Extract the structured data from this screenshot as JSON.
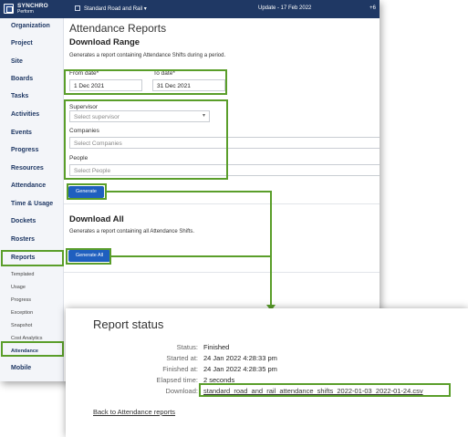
{
  "topbar": {
    "logo_line1": "SYNCHRO",
    "logo_line2": "Perform",
    "project": "Standard Road and Rail",
    "project_caret": "▾",
    "update": "Update - 17 Feb 2022",
    "extra": "+6"
  },
  "sidebar": {
    "items": [
      "Organization",
      "Project",
      "Site",
      "Boards",
      "Tasks",
      "Activities",
      "Events",
      "Progress",
      "Resources",
      "Attendance",
      "Time & Usage",
      "Dockets",
      "Rosters",
      "Reports",
      "Mobile"
    ],
    "sub_items": [
      "Templated",
      "Usage",
      "Progress",
      "Exception",
      "Snapshot",
      "Cost Analytics",
      "Attendance"
    ]
  },
  "main": {
    "page_title": "Attendance Reports",
    "range_heading": "Download Range",
    "range_desc": "Generates a report containing Attendance Shifts during a period.",
    "from_label": "From date*",
    "from_value": "1 Dec 2021",
    "to_label": "To date*",
    "to_value": "31 Dec 2021",
    "supervisor_label": "Supervisor",
    "supervisor_placeholder": "Select supervisor",
    "companies_label": "Companies",
    "companies_placeholder": "Select Companies",
    "people_label": "People",
    "people_placeholder": "Select People",
    "generate_label": "Generate",
    "all_heading": "Download All",
    "all_desc": "Generates a report containing all Attendance Shifts.",
    "generate_all_label": "Generate All"
  },
  "status": {
    "title": "Report status",
    "rows": [
      {
        "label": "Status:",
        "value": "Finished"
      },
      {
        "label": "Started at:",
        "value": "24 Jan 2022 4:28:33 pm"
      },
      {
        "label": "Finished at:",
        "value": "24 Jan 2022 4:28:35 pm"
      },
      {
        "label": "Elapsed time:",
        "value": "2 seconds"
      },
      {
        "label": "Download:",
        "value": "standard_road_and_rail_attendance_shifts_2022-01-03_2022-01-24.csv"
      }
    ],
    "back_link": "Back to Attendance reports"
  },
  "colors": {
    "brand_navy": "#1f3864",
    "button_blue": "#1f5fbf",
    "highlight_green": "#5a9e2a"
  }
}
